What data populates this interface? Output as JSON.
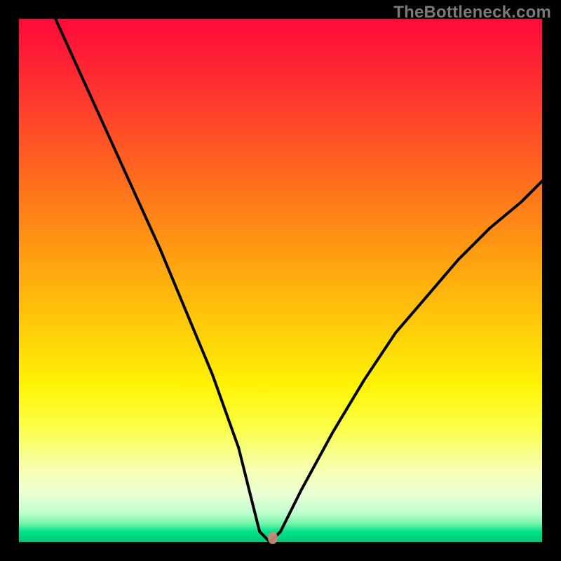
{
  "watermark": "TheBottleneck.com",
  "chart_data": {
    "type": "line",
    "title": "",
    "xlabel": "",
    "ylabel": "",
    "xlim": [
      0,
      100
    ],
    "ylim": [
      0,
      100
    ],
    "grid": false,
    "legend": false,
    "description": "V-shaped bottleneck curve over red-to-green vertical gradient; minimum near x≈47 at y≈0.",
    "series": [
      {
        "name": "bottleneck-curve",
        "x": [
          7,
          12,
          17,
          22,
          27,
          32,
          37,
          42,
          44,
          46,
          48,
          50,
          54,
          60,
          66,
          72,
          78,
          84,
          90,
          96,
          100
        ],
        "y": [
          100,
          89,
          78,
          67,
          56,
          44,
          32,
          18,
          10,
          2,
          0,
          2,
          10,
          21,
          31,
          40,
          47,
          54,
          60,
          65,
          69
        ]
      }
    ],
    "marker": {
      "x": 48.5,
      "y": 0.8,
      "color": "#c98a7a"
    },
    "gradient_stops": [
      {
        "pct": 0,
        "color": "#ff0b3b"
      },
      {
        "pct": 30,
        "color": "#ff6a1e"
      },
      {
        "pct": 58,
        "color": "#ffc90a"
      },
      {
        "pct": 78,
        "color": "#fbff46"
      },
      {
        "pct": 96.5,
        "color": "#72f4a8"
      },
      {
        "pct": 100,
        "color": "#00c876"
      }
    ]
  }
}
